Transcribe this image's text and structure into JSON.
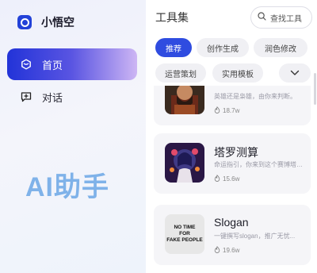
{
  "brand": {
    "name": "小悟空",
    "logo_icon": "app-logo-icon",
    "color": "#2342d8"
  },
  "nav": [
    {
      "label": "首页",
      "icon": "cube-icon",
      "active": true
    },
    {
      "label": "对话",
      "icon": "chat-icon",
      "active": false
    }
  ],
  "watermark": "AI助手",
  "main": {
    "title": "工具集",
    "search": {
      "placeholder": "查找工具",
      "icon": "search-icon"
    },
    "tags": [
      {
        "label": "推荐",
        "active": true
      },
      {
        "label": "创作生成",
        "active": false
      },
      {
        "label": "润色修改",
        "active": false
      },
      {
        "label": "运营策划",
        "active": false
      },
      {
        "label": "实用模板",
        "active": false
      }
    ],
    "more_icon": "chevron-down-icon",
    "cards": [
      {
        "title": "",
        "desc": "英雄还是枭雄，由你来判断。",
        "count": "18.7w"
      },
      {
        "title": "塔罗测算",
        "desc": "命运指引，你来到这个赛博塔罗...",
        "count": "15.6w"
      },
      {
        "title": "Slogan",
        "desc": "一键撰写slogan，推广无忧...",
        "count": "19.6w",
        "thumb_text": [
          "NO TIME",
          "FOR",
          "FAKE PEOPLE"
        ]
      }
    ]
  },
  "colors": {
    "accent": "#2f4ce0",
    "watermark": "#7fb2e9"
  }
}
